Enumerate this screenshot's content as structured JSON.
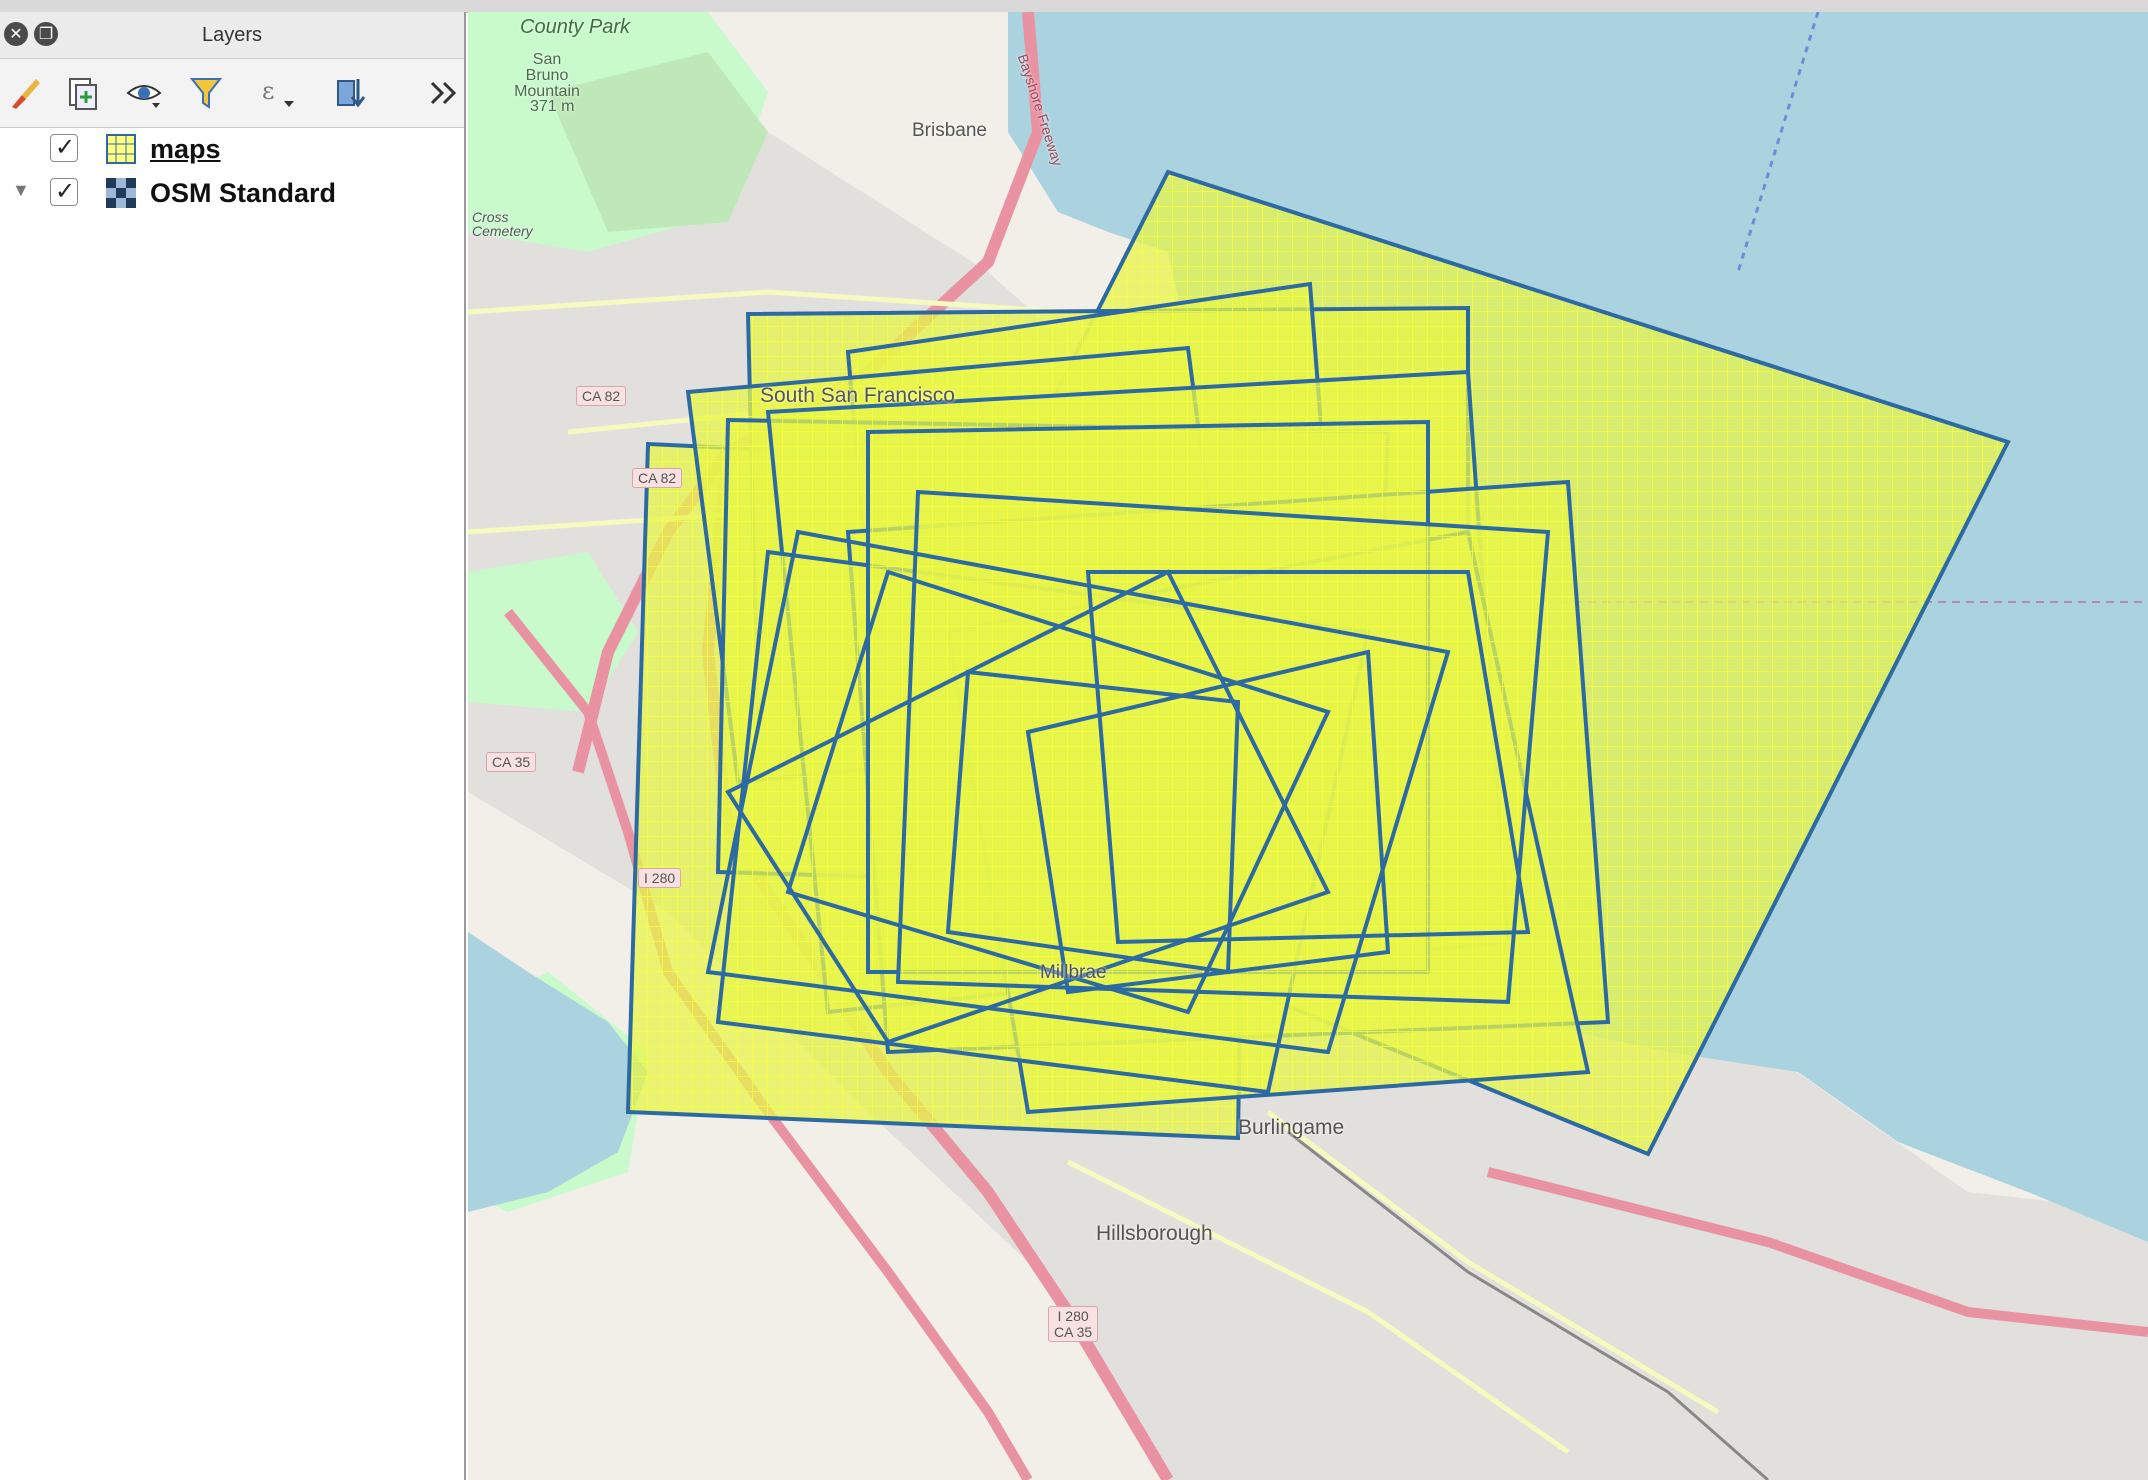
{
  "panel": {
    "title": "Layers"
  },
  "toolbar": {
    "items": [
      {
        "icon": "paintbrush-icon"
      },
      {
        "icon": "add-group-icon"
      },
      {
        "icon": "eye-visibility-icon"
      },
      {
        "icon": "filter-icon"
      },
      {
        "icon": "expression-filter-icon"
      },
      {
        "icon": "sort-layers-icon"
      },
      {
        "icon": "more-chevrons-icon"
      }
    ]
  },
  "layers": [
    {
      "name": "maps",
      "checked": true,
      "icon": "polygon-grid-icon"
    },
    {
      "name": "OSM Standard",
      "checked": true,
      "icon": "raster-tile-icon"
    }
  ],
  "map": {
    "places": {
      "county_park": "County Park",
      "san_bruno_mountain": "San Bruno Mountain",
      "elevation": "371 m",
      "brisbane": "Brisbane",
      "south_sf": "South San Francisco",
      "hillsborough": "Hillsborough",
      "burlingame": "Burlingame",
      "millbrae": "Millbrae",
      "cross_cemetery": "Cross Cemetery",
      "bayshore": "Bayshore Freeway"
    },
    "shields": {
      "ca82_a": "CA 82",
      "ca82_b": "CA 82",
      "ca35": "CA 35",
      "i280": "I 280",
      "i280_ca35_a": "I 280",
      "i280_ca35_b": "CA 35"
    },
    "colors": {
      "water": "#aad3df",
      "land": "#f2efe9",
      "park": "#c8facc",
      "urban": "#e0dfdf",
      "motorway": "#e892a2",
      "polygon_fill": "#ffff4d",
      "polygon_stroke": "#2d6aa3"
    }
  }
}
